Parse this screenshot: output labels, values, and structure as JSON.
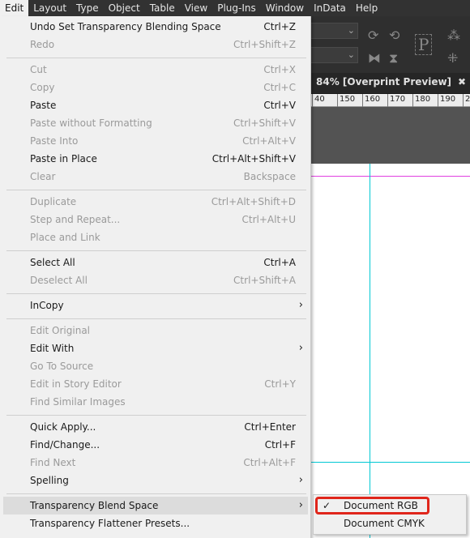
{
  "menubar": [
    "Edit",
    "Layout",
    "Type",
    "Object",
    "Table",
    "View",
    "Plug-Ins",
    "Window",
    "InData",
    "Help"
  ],
  "document_tab": {
    "title": "84% [Overprint Preview]",
    "close": "✖"
  },
  "ruler": {
    "labels": [
      "40",
      "150",
      "160",
      "170",
      "180",
      "190",
      "20"
    ]
  },
  "colors": {
    "highlight_box": "#e0261b",
    "guide": "#00c8d4",
    "guide_margin": "#e040e0"
  },
  "edit_menu": [
    {
      "label": "Undo Set Transparency Blending Space",
      "shortcut": "Ctrl+Z",
      "enabled": true
    },
    {
      "label": "Redo",
      "shortcut": "Ctrl+Shift+Z",
      "enabled": false
    },
    {
      "separator": true
    },
    {
      "label": "Cut",
      "shortcut": "Ctrl+X",
      "enabled": false
    },
    {
      "label": "Copy",
      "shortcut": "Ctrl+C",
      "enabled": false
    },
    {
      "label": "Paste",
      "shortcut": "Ctrl+V",
      "enabled": true
    },
    {
      "label": "Paste without Formatting",
      "shortcut": "Ctrl+Shift+V",
      "enabled": false
    },
    {
      "label": "Paste Into",
      "shortcut": "Ctrl+Alt+V",
      "enabled": false
    },
    {
      "label": "Paste in Place",
      "shortcut": "Ctrl+Alt+Shift+V",
      "enabled": true
    },
    {
      "label": "Clear",
      "shortcut": "Backspace",
      "enabled": false
    },
    {
      "separator": true
    },
    {
      "label": "Duplicate",
      "shortcut": "Ctrl+Alt+Shift+D",
      "enabled": false
    },
    {
      "label": "Step and Repeat...",
      "shortcut": "Ctrl+Alt+U",
      "enabled": false
    },
    {
      "label": "Place and Link",
      "shortcut": "",
      "enabled": false
    },
    {
      "separator": true
    },
    {
      "label": "Select All",
      "shortcut": "Ctrl+A",
      "enabled": true
    },
    {
      "label": "Deselect All",
      "shortcut": "Ctrl+Shift+A",
      "enabled": false
    },
    {
      "separator": true
    },
    {
      "label": "InCopy",
      "shortcut": "",
      "enabled": true,
      "submenu": true
    },
    {
      "separator": true
    },
    {
      "label": "Edit Original",
      "shortcut": "",
      "enabled": false
    },
    {
      "label": "Edit With",
      "shortcut": "",
      "enabled": true,
      "submenu": true
    },
    {
      "label": "Go To Source",
      "shortcut": "",
      "enabled": false
    },
    {
      "label": "Edit in Story Editor",
      "shortcut": "Ctrl+Y",
      "enabled": false
    },
    {
      "label": "Find Similar Images",
      "shortcut": "",
      "enabled": false
    },
    {
      "separator": true
    },
    {
      "label": "Quick Apply...",
      "shortcut": "Ctrl+Enter",
      "enabled": true
    },
    {
      "label": "Find/Change...",
      "shortcut": "Ctrl+F",
      "enabled": true
    },
    {
      "label": "Find Next",
      "shortcut": "Ctrl+Alt+F",
      "enabled": false
    },
    {
      "label": "Spelling",
      "shortcut": "",
      "enabled": true,
      "submenu": true
    },
    {
      "separator": true
    },
    {
      "label": "Transparency Blend Space",
      "shortcut": "",
      "enabled": true,
      "submenu": true,
      "highlighted": true
    },
    {
      "label": "Transparency Flattener Presets...",
      "shortcut": "",
      "enabled": true
    }
  ],
  "submenu": [
    {
      "label": "Document RGB",
      "checked": true
    },
    {
      "label": "Document CMYK",
      "checked": false
    }
  ],
  "icons": {
    "check": "✓",
    "arrow": "›",
    "chevron": "⌄"
  }
}
